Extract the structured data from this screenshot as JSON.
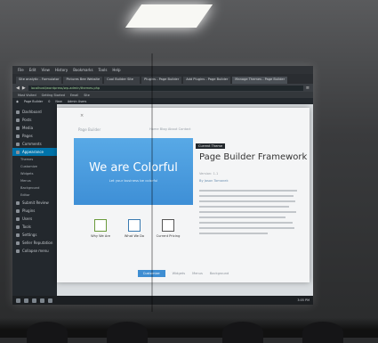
{
  "browser": {
    "menu": [
      "File",
      "Edit",
      "View",
      "History",
      "Bookmarks",
      "Tools",
      "Help"
    ],
    "tabs": [
      {
        "label": "Site analytic - Formulator",
        "active": false
      },
      {
        "label": "Pictures Bee Website",
        "active": false
      },
      {
        "label": "Cool Builder Site",
        "active": false
      },
      {
        "label": "Plugins - Page Builder",
        "active": false
      },
      {
        "label": "Add Plugins - Page Builder",
        "active": false
      },
      {
        "label": "Manage Themes - Page Builder",
        "active": true
      }
    ],
    "url": "localhost/wordpress/wp-admin/themes.php",
    "bookmarks": [
      "Most Visited",
      "Getting Started",
      "Email",
      "Site"
    ],
    "wpbar": [
      "Page Builder",
      "0",
      "New",
      "Admin Users"
    ]
  },
  "sidebar": {
    "items": [
      {
        "label": "Dashboard",
        "active": false,
        "sub": false
      },
      {
        "label": "Posts",
        "active": false,
        "sub": false
      },
      {
        "label": "Media",
        "active": false,
        "sub": false
      },
      {
        "label": "Pages",
        "active": false,
        "sub": false
      },
      {
        "label": "Comments",
        "active": false,
        "sub": false
      },
      {
        "label": "Appearance",
        "active": true,
        "sub": false
      },
      {
        "label": "Themes",
        "active": false,
        "sub": true
      },
      {
        "label": "Customize",
        "active": false,
        "sub": true
      },
      {
        "label": "Widgets",
        "active": false,
        "sub": true
      },
      {
        "label": "Menus",
        "active": false,
        "sub": true
      },
      {
        "label": "Background",
        "active": false,
        "sub": true
      },
      {
        "label": "Editor",
        "active": false,
        "sub": true
      },
      {
        "label": "Submit Review",
        "active": false,
        "sub": false
      },
      {
        "label": "Plugins",
        "active": false,
        "sub": false
      },
      {
        "label": "Users",
        "active": false,
        "sub": false
      },
      {
        "label": "Tools",
        "active": false,
        "sub": false
      },
      {
        "label": "Settings",
        "active": false,
        "sub": false
      },
      {
        "label": "Seller Reputation",
        "active": false,
        "sub": false
      },
      {
        "label": "Collapse menu",
        "active": false,
        "sub": false
      }
    ]
  },
  "modal": {
    "close_icon": "×",
    "top_title": "Page Builder",
    "top_links": "Home  Blog  About  Contact",
    "preview_title": "We are Colorful",
    "preview_subtitle": "Let your business be colorful",
    "features": [
      {
        "label": "Why We Are",
        "icon": "document-icon"
      },
      {
        "label": "What We Do",
        "icon": "monitor-icon"
      },
      {
        "label": "Current Pricing",
        "icon": "box-icon"
      }
    ],
    "current_badge": "Current Theme",
    "theme_title": "Page Builder Framework",
    "version": "Version: 1.1",
    "author": "By Jason Tomanek",
    "footer_primary": "Customize",
    "footer_links": [
      "Widgets",
      "Menus",
      "Background"
    ]
  },
  "taskbar": {
    "time": "3:05 PM"
  },
  "colors": {
    "accent": "#0073aa",
    "preview": "#4a9de0",
    "admin_dark": "#23282d"
  }
}
